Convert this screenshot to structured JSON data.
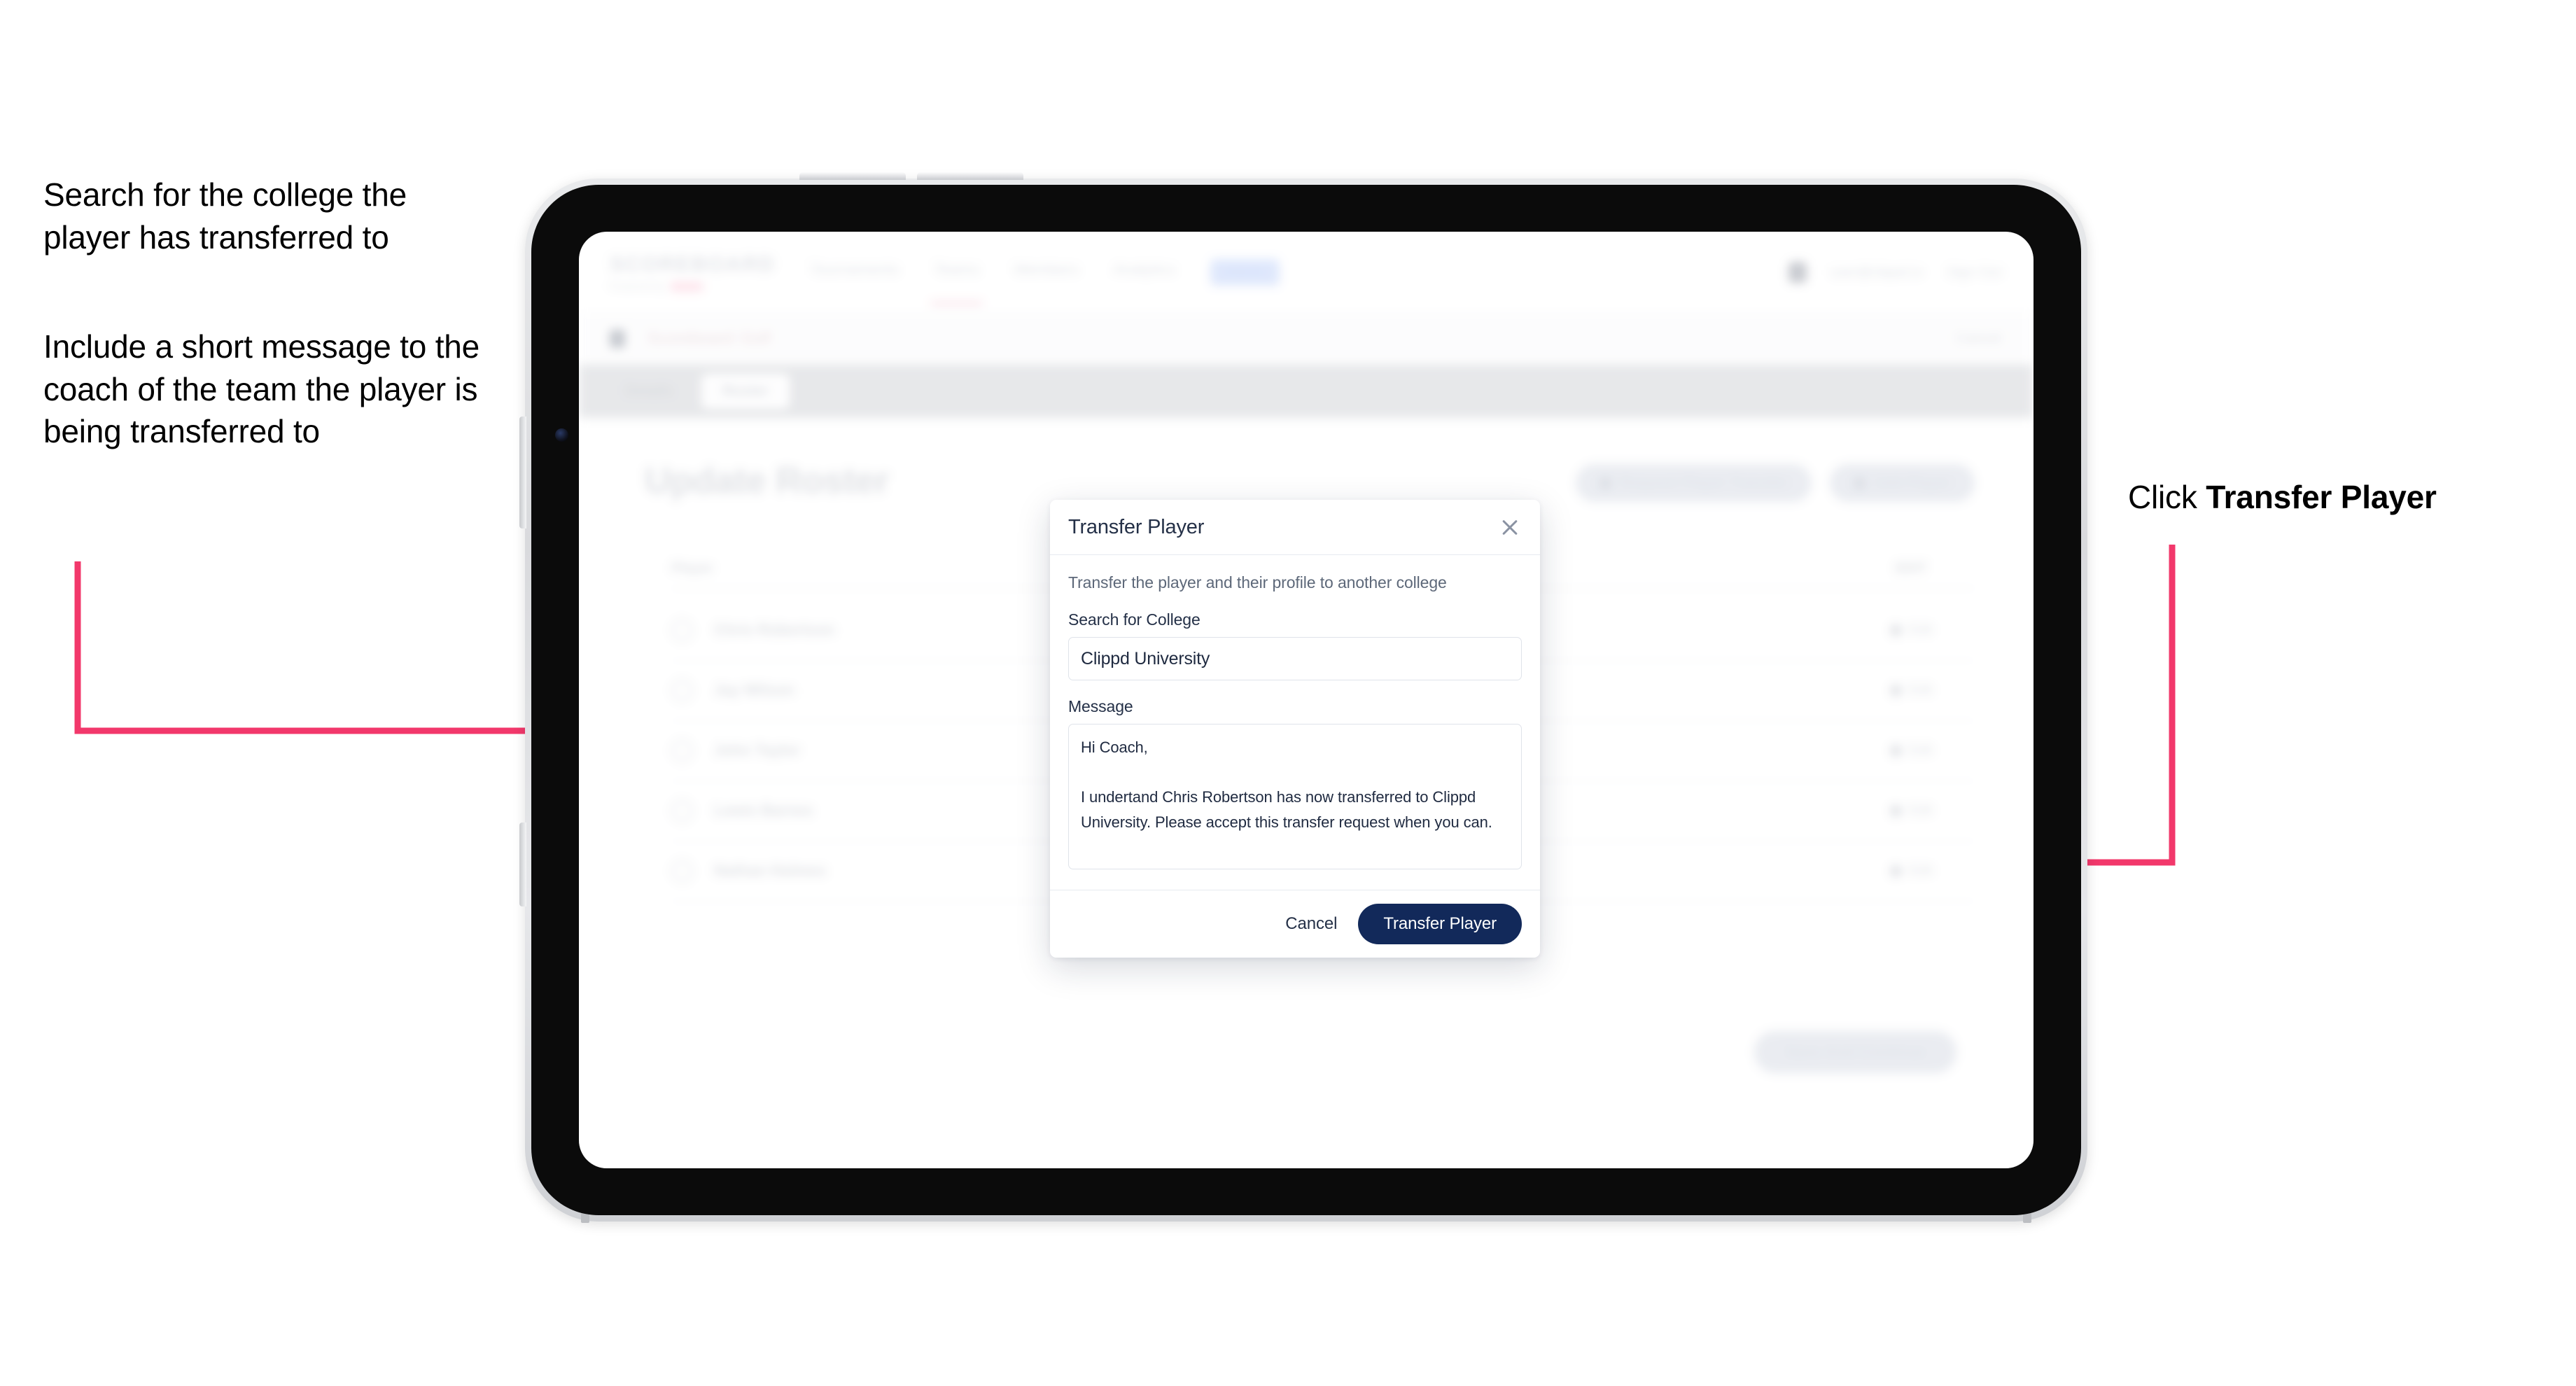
{
  "annotations": {
    "left_1": "Search for the college the player has transferred to",
    "left_2": "Include a short message to the coach of the team the player is being transferred to",
    "right_prefix": "Click ",
    "right_strong": "Transfer Player"
  },
  "colors": {
    "arrow_pink": "#f2386b",
    "primary_navy": "#12295a",
    "modal_title": "#243047",
    "device_bezel": "#0b0b0b"
  },
  "app": {
    "brand": {
      "name": "SCOREBOARD",
      "tagline": "Powered by",
      "chip": ""
    },
    "topnav": [
      {
        "label": "Tournaments",
        "active": false
      },
      {
        "label": "Teams",
        "active": true
      },
      {
        "label": "Members",
        "active": false
      },
      {
        "label": "Analytics",
        "active": false
      }
    ],
    "topnav_pill": "Admin",
    "topright": {
      "user": "user@clippd.io",
      "signout": "Sign Out"
    },
    "subbar": {
      "title": "Scoreboard",
      "suffix": "Golf",
      "right": "Cancel"
    },
    "tabs": [
      {
        "label": "Details",
        "active": false
      },
      {
        "label": "Roster",
        "active": true
      }
    ],
    "heading": "Update Roster",
    "head_actions": [
      {
        "label": "Request Player Transfer"
      },
      {
        "label": "Add Player"
      }
    ],
    "list_header": {
      "left": "Player",
      "right": "EDIT"
    },
    "players": [
      {
        "name": "Chris Robertson",
        "action": "Edit"
      },
      {
        "name": "Jay Wilson",
        "action": "Edit"
      },
      {
        "name": "John Taylor",
        "action": "Edit"
      },
      {
        "name": "Lewis Barnes",
        "action": "Edit"
      },
      {
        "name": "Nathan Holmes",
        "action": "Edit"
      }
    ],
    "bottom_action": "Save And Continue"
  },
  "modal": {
    "title": "Transfer Player",
    "close_icon": "close-icon",
    "description": "Transfer the player and their profile to another college",
    "college_label": "Search for College",
    "college_value": "Clippd University",
    "college_placeholder": "Search for College",
    "message_label": "Message",
    "message_value": "Hi Coach,\n\nI undertand Chris Robertson has now transferred to Clippd University. Please accept this transfer request when you can.",
    "message_placeholder": "Message",
    "cancel_label": "Cancel",
    "submit_label": "Transfer Player"
  }
}
